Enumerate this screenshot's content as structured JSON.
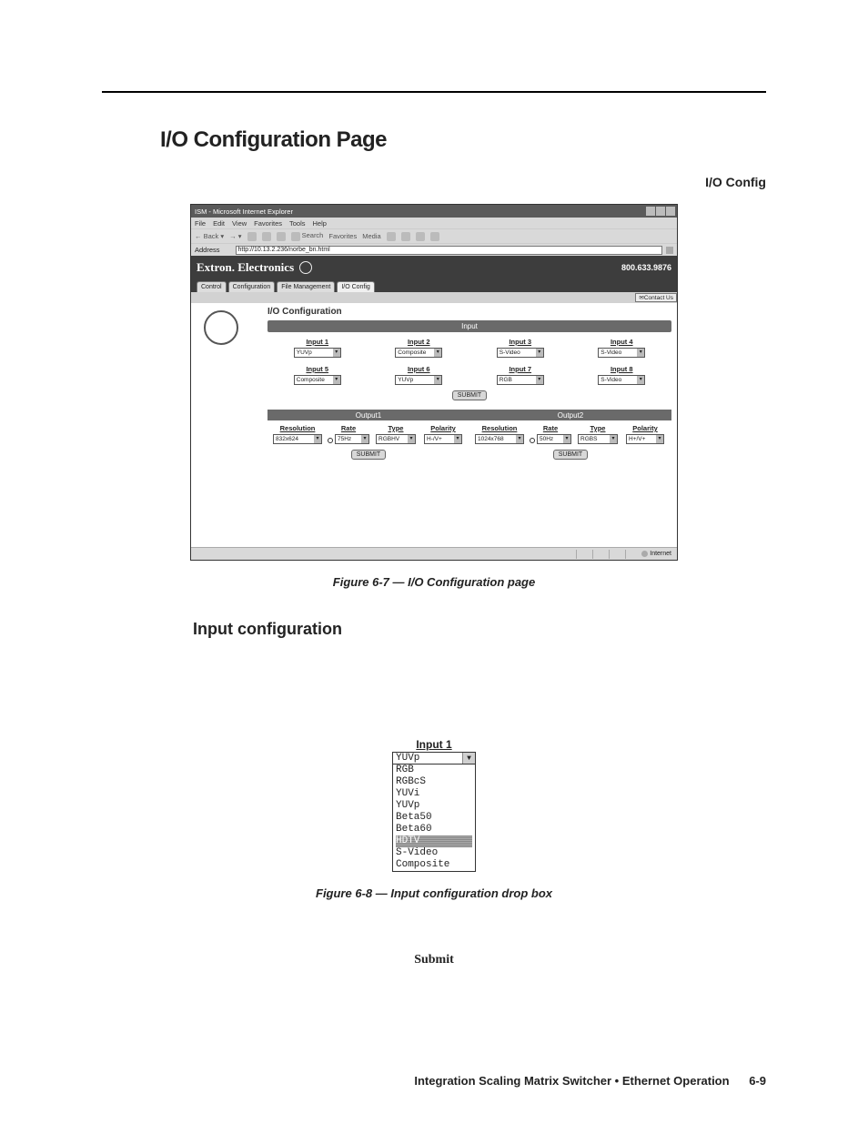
{
  "page": {
    "h1": "I/O Configuration Page",
    "tab_label": "I/O Config",
    "fig67_caption": "Figure 6-7 — I/O Configuration page",
    "h2": "Input configuration",
    "fig68_caption": "Figure 6-8 — Input configuration drop box",
    "submit_word": "Submit"
  },
  "footer": {
    "text": "Integration Scaling Matrix Switcher • Ethernet Operation",
    "page_num": "6-9"
  },
  "ie": {
    "title": "ISM - Microsoft Internet Explorer",
    "menus": [
      "File",
      "Edit",
      "View",
      "Favorites",
      "Tools",
      "Help"
    ],
    "tb_back": "Back",
    "tb_search": "Search",
    "tb_fav": "Favorites",
    "tb_media": "Media",
    "addr_label": "Address",
    "addr_value": "http://10.13.2.236/norbe_bn.html",
    "brand": "Extron. Electronics",
    "phone": "800.633.9876",
    "tabs": [
      "Control",
      "Configuration",
      "File Management",
      "I/O Config"
    ],
    "contact": "Contact Us",
    "panel_title": "I/O Configuration",
    "input_hdr": "Input",
    "inputs": [
      {
        "label": "Input 1",
        "value": "YUVp"
      },
      {
        "label": "Input 2",
        "value": "Composite"
      },
      {
        "label": "Input 3",
        "value": "S-Video"
      },
      {
        "label": "Input 4",
        "value": "S-Video"
      },
      {
        "label": "Input 5",
        "value": "Composite"
      },
      {
        "label": "Input 6",
        "value": "YUVp"
      },
      {
        "label": "Input 7",
        "value": "RGB"
      },
      {
        "label": "Input 8",
        "value": "S-Video"
      }
    ],
    "submit": "SUBMIT",
    "out1_hdr": "Output1",
    "out2_hdr": "Output2",
    "out_labels": {
      "res": "Resolution",
      "rate": "Rate",
      "type": "Type",
      "pol": "Polarity"
    },
    "out1": {
      "res": "832x624",
      "rate": "75Hz",
      "type": "RGBHV",
      "pol": "H-/V+"
    },
    "out2": {
      "res": "1024x768",
      "rate": "50Hz",
      "type": "RGBS",
      "pol": "H+/V+"
    },
    "status": "Internet"
  },
  "dropdown": {
    "label": "Input 1",
    "selected": "YUVp",
    "options": [
      "RGB",
      "RGBcS",
      "YUVi",
      "YUVp",
      "Beta50",
      "Beta60",
      "HDTV",
      "S-Video",
      "Composite"
    ],
    "highlighted": "HDTV"
  }
}
